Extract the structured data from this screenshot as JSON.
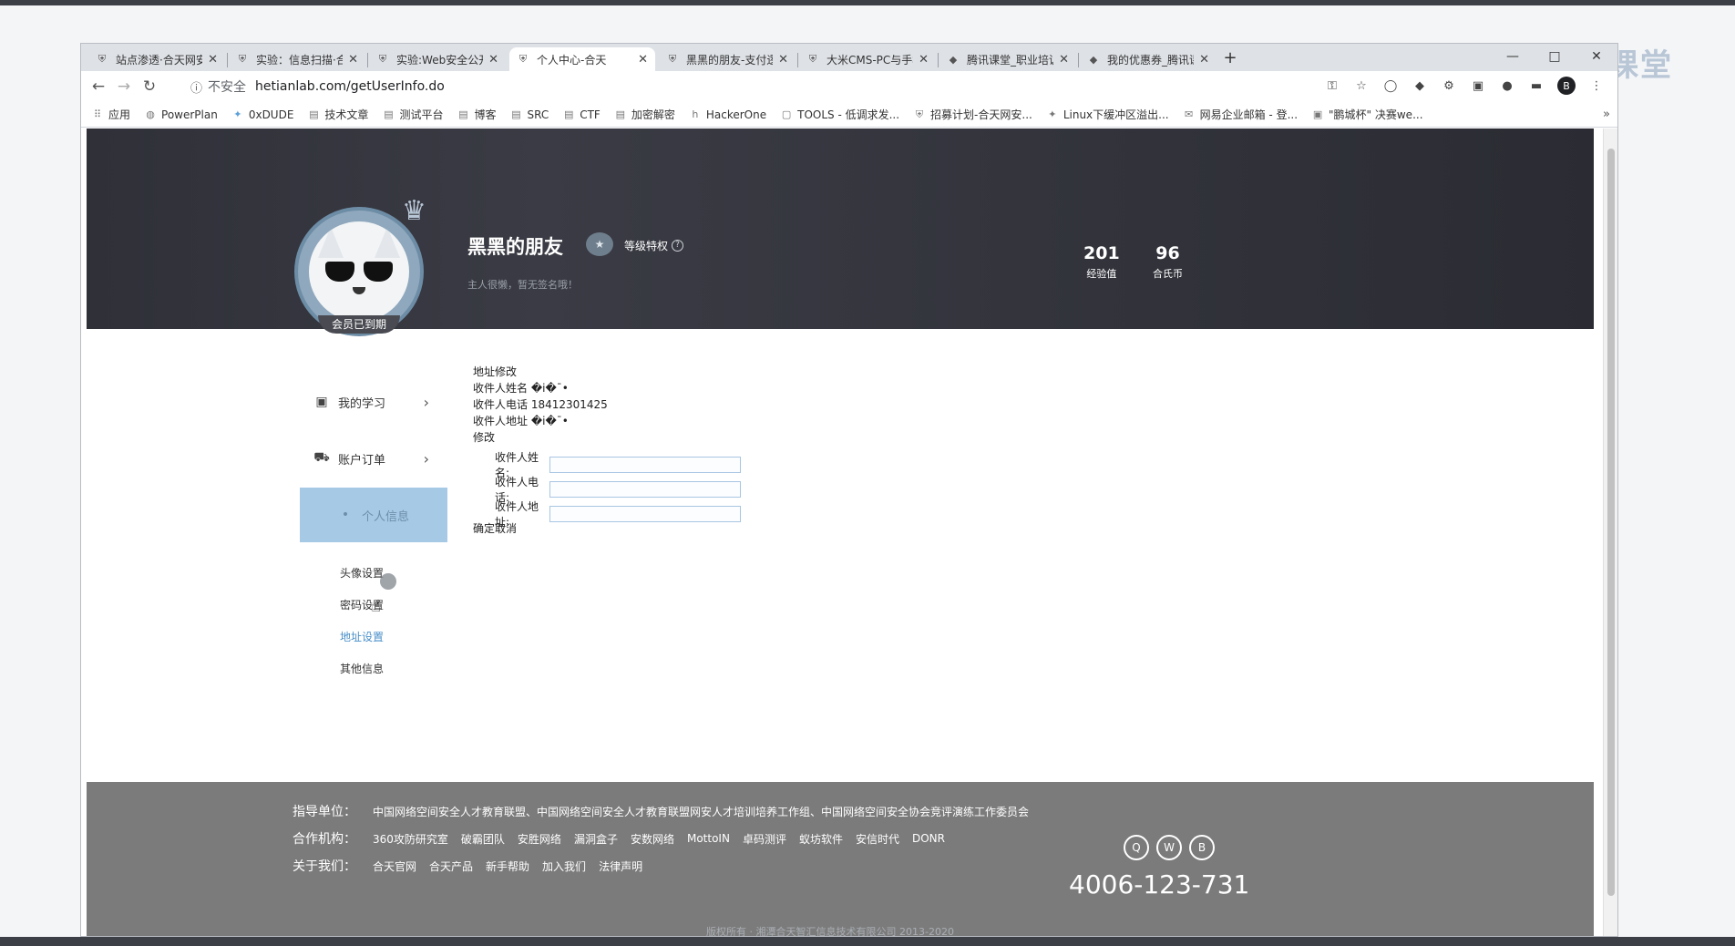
{
  "browser": {
    "tabs": [
      {
        "title": "站点渗透·合天网安实"
      },
      {
        "title": "实验：信息扫描·合天网"
      },
      {
        "title": "实验:Web安全公开课"
      },
      {
        "title": "个人中心-合天"
      },
      {
        "title": "黑黑的朋友-支付逻辑"
      },
      {
        "title": "大米CMS-PC与手机端"
      },
      {
        "title": "腾讯课堂_职业培训"
      },
      {
        "title": "我的优惠券_腾讯课堂"
      }
    ],
    "new_tab": "+",
    "window_controls": {
      "minimize": "—",
      "maximize": "□",
      "close": "✕"
    },
    "address": {
      "security_label": "不安全",
      "url": "hetianlab.com/getUserInfo.do"
    },
    "profile_initial": "B",
    "bookmarks": [
      {
        "label": "应用",
        "icon": "apps-grid-icon"
      },
      {
        "label": "PowerPlan",
        "icon": "globe-icon"
      },
      {
        "label": "0xDUDE",
        "icon": "bird-icon"
      },
      {
        "label": "技术文章",
        "icon": "folder-icon"
      },
      {
        "label": "测试平台",
        "icon": "folder-icon"
      },
      {
        "label": "博客",
        "icon": "folder-icon"
      },
      {
        "label": "SRC",
        "icon": "folder-icon"
      },
      {
        "label": "CTF",
        "icon": "folder-icon"
      },
      {
        "label": "加密解密",
        "icon": "folder-icon"
      },
      {
        "label": "HackerOne",
        "icon": "h-icon"
      },
      {
        "label": "TOOLS - 低调求发...",
        "icon": "page-icon"
      },
      {
        "label": "招募计划-合天网安...",
        "icon": "shield-icon"
      },
      {
        "label": "Linux下缓冲区溢出...",
        "icon": "bird-icon"
      },
      {
        "label": "网易企业邮箱 - 登...",
        "icon": "mail-icon"
      },
      {
        "label": "\"鹏城杯\" 决赛we...",
        "icon": "image-icon"
      }
    ],
    "bookmarks_more": "»"
  },
  "watermark": {
    "brand": "腾讯课堂"
  },
  "profile": {
    "username": "黑黑的朋友",
    "level_privilege": "等级特权",
    "signature": "主人很懒，暂无签名哦！",
    "member_status": "会员已到期",
    "stats": [
      {
        "value": "201",
        "label": "经验值"
      },
      {
        "value": "96",
        "label": "合氏币"
      }
    ]
  },
  "menu": {
    "items": [
      {
        "label": "我的学习"
      },
      {
        "label": "账户订单"
      },
      {
        "label": "个人信息"
      }
    ],
    "submenu": [
      {
        "label": "头像设置"
      },
      {
        "label": "密码设置"
      },
      {
        "label": "地址设置"
      },
      {
        "label": "其他信息"
      }
    ]
  },
  "address": {
    "title": "地址修改",
    "name_line": "收件人姓名 �i�ˉ•",
    "phone_line": "收件人电话 18412301425",
    "addr_line": "收件人地址 �i�ˉ•",
    "edit": "修改",
    "form": {
      "name_label": "收件人姓名:",
      "phone_label": "收件人电话:",
      "addr_label": "收件人地址:"
    },
    "confirm": "确定",
    "cancel": "取消"
  },
  "footer": {
    "guide_heading": "指导单位：",
    "guide_text": "中国网络空间安全人才教育联盟、中国网络空间安全人才教育联盟网安人才培训培养工作组、中国网络空间安全协会竞评演练工作委员会",
    "partners_heading": "合作机构：",
    "partners": [
      "360攻防研究室",
      "破霸团队",
      "安胜网络",
      "漏洞盒子",
      "安数网络",
      "MottoIN",
      "卓码测评",
      "蚁坊软件",
      "安信时代",
      "DONR"
    ],
    "about_heading": "关于我们：",
    "about": [
      "合天官网",
      "合天产品",
      "新手帮助",
      "加入我们",
      "法律声明"
    ],
    "hotline": "4006-123-731",
    "copyright": "版权所有 · 湘潭合天智汇信息技术有限公司 2013-2020"
  },
  "colors": {
    "banner": "#2f3038",
    "menu_active": "#a6c9e6",
    "link_blue": "#4a8fc9",
    "footer": "#7b7b7b"
  }
}
